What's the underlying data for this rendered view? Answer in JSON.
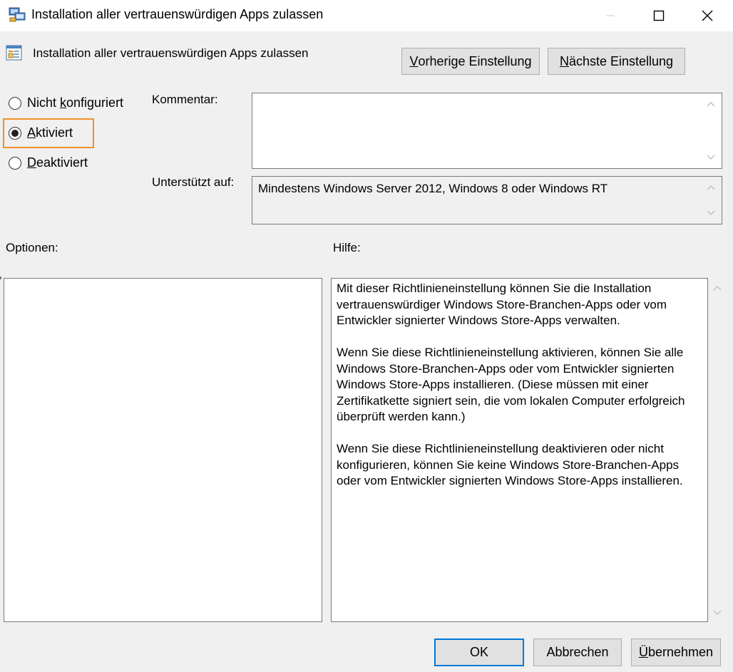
{
  "window": {
    "title": "Installation aller vertrauenswürdigen Apps zulassen",
    "icon": "policy-window-icon",
    "controls": [
      "minimize-icon",
      "maximize-icon",
      "close-icon"
    ]
  },
  "header": {
    "icon": "policy-setting-icon",
    "title": "Installation aller vertrauenswürdigen Apps zulassen",
    "prev_button": {
      "before": "",
      "accel": "V",
      "after": "orherige Einstellung"
    },
    "next_button": {
      "before": "",
      "accel": "N",
      "after": "ächste Einstellung"
    }
  },
  "state": {
    "options": [
      {
        "before": "Nicht ",
        "accel": "k",
        "after": "onfiguriert",
        "selected": false
      },
      {
        "before": "",
        "accel": "A",
        "after": "ktiviert",
        "selected": true
      },
      {
        "before": "",
        "accel": "D",
        "after": "eaktiviert",
        "selected": false
      }
    ],
    "highlight_color": "#f0922b"
  },
  "comment": {
    "label": "Kommentar:",
    "value": ""
  },
  "supported": {
    "label": "Unterstützt auf:",
    "value": "Mindestens Windows Server 2012, Windows 8 oder Windows RT"
  },
  "options_panel": {
    "label": "Optionen:"
  },
  "help": {
    "label": "Hilfe:",
    "paragraphs": [
      "Mit dieser Richtlinieneinstellung können Sie die Installation vertrauenswürdiger Windows Store-Branchen-Apps oder vom Entwickler signierter Windows Store-Apps verwalten.",
      "Wenn Sie diese Richtlinieneinstellung aktivieren, können Sie alle Windows Store-Branchen-Apps oder vom Entwickler signierten Windows Store-Apps installieren. (Diese müssen mit einer Zertifikatkette signiert sein, die vom lokalen Computer erfolgreich überprüft werden kann.)",
      "Wenn Sie diese Richtlinieneinstellung deaktivieren oder nicht konfigurieren, können Sie keine Windows Store-Branchen-Apps oder vom Entwickler signierten Windows Store-Apps installieren."
    ]
  },
  "footer": {
    "ok": "OK",
    "cancel": "Abbrechen",
    "apply": {
      "before": "",
      "accel": "Ü",
      "after": "bernehmen"
    }
  },
  "colors": {
    "accent": "#0078d7",
    "dialog_bg": "#f0f0f0"
  }
}
